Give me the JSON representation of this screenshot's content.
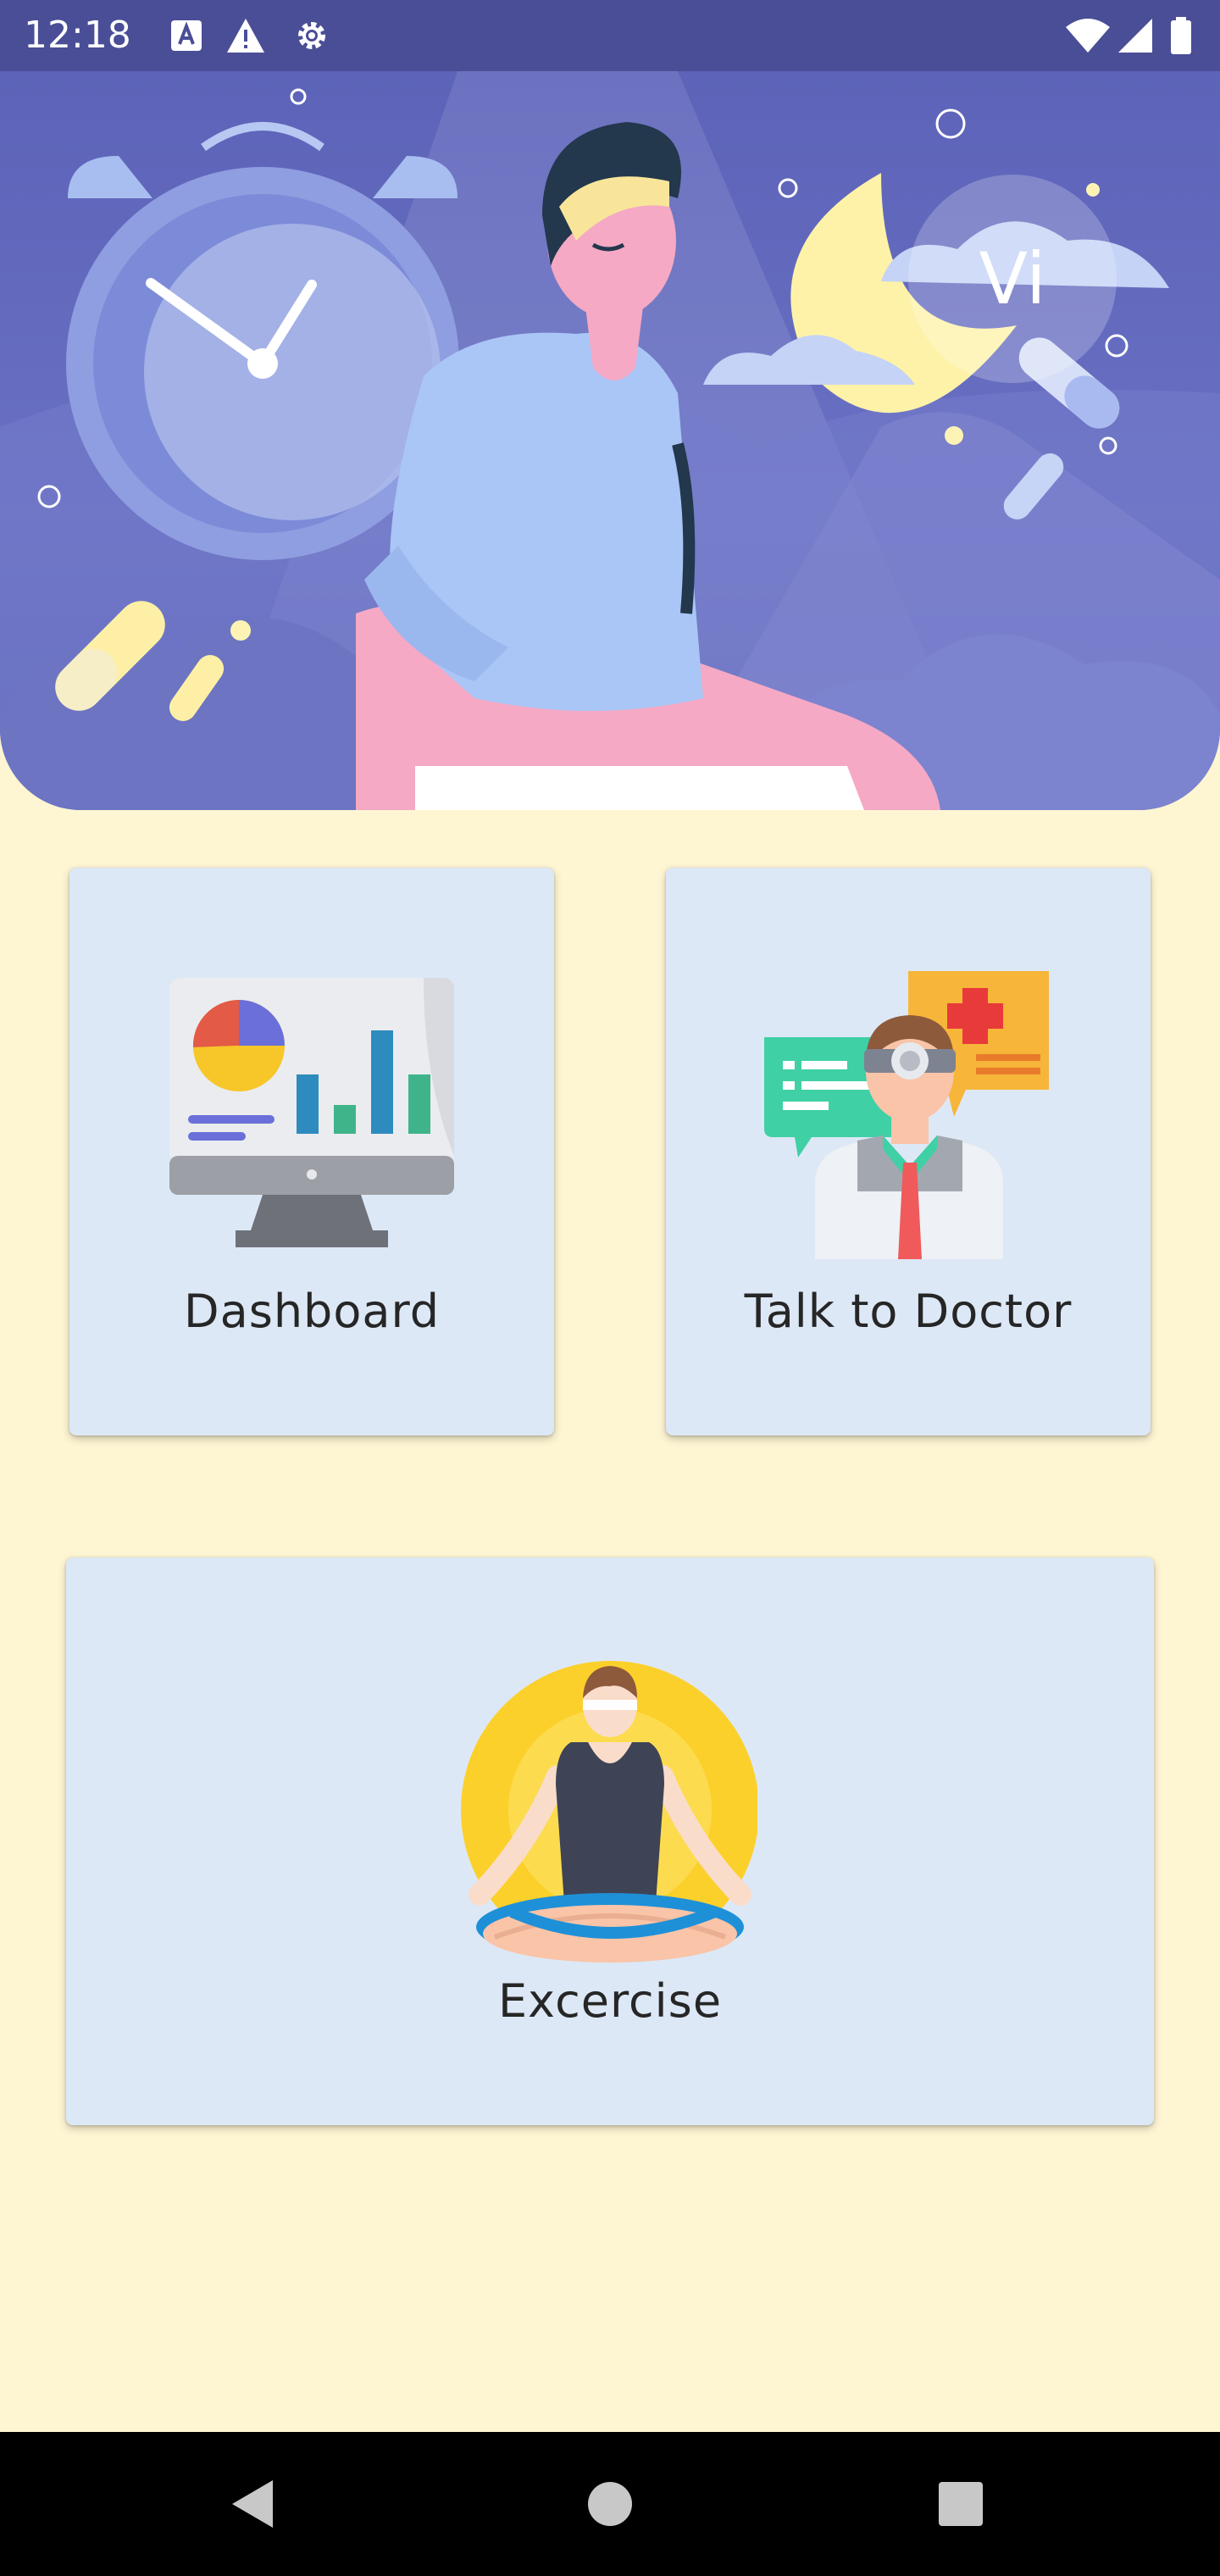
{
  "status_bar": {
    "time": "12:18",
    "left_icons": [
      "font-icon",
      "warning-icon",
      "settings-gear-icon"
    ],
    "right_icons": [
      "wifi-icon",
      "cellular-signal-icon",
      "battery-icon"
    ]
  },
  "hero": {
    "avatar_initials": "Vi",
    "illustration": "sleeping-man-with-alarm-clock-moon-clouds"
  },
  "cards": {
    "dashboard": {
      "label": "Dashboard",
      "icon": "dashboard-monitor-chart-icon"
    },
    "talk_to_doctor": {
      "label": "Talk to Doctor",
      "icon": "doctor-chat-icon"
    },
    "exercise": {
      "label": "Excercise",
      "icon": "meditation-yoga-icon"
    }
  },
  "nav_bar": {
    "buttons": [
      "back",
      "home",
      "recents"
    ]
  },
  "colors": {
    "background": "#FEF6D3",
    "status_bar": "#4A4E96",
    "hero": "#6A71C4",
    "card": "#DDE8F6",
    "label_text": "#262626"
  }
}
